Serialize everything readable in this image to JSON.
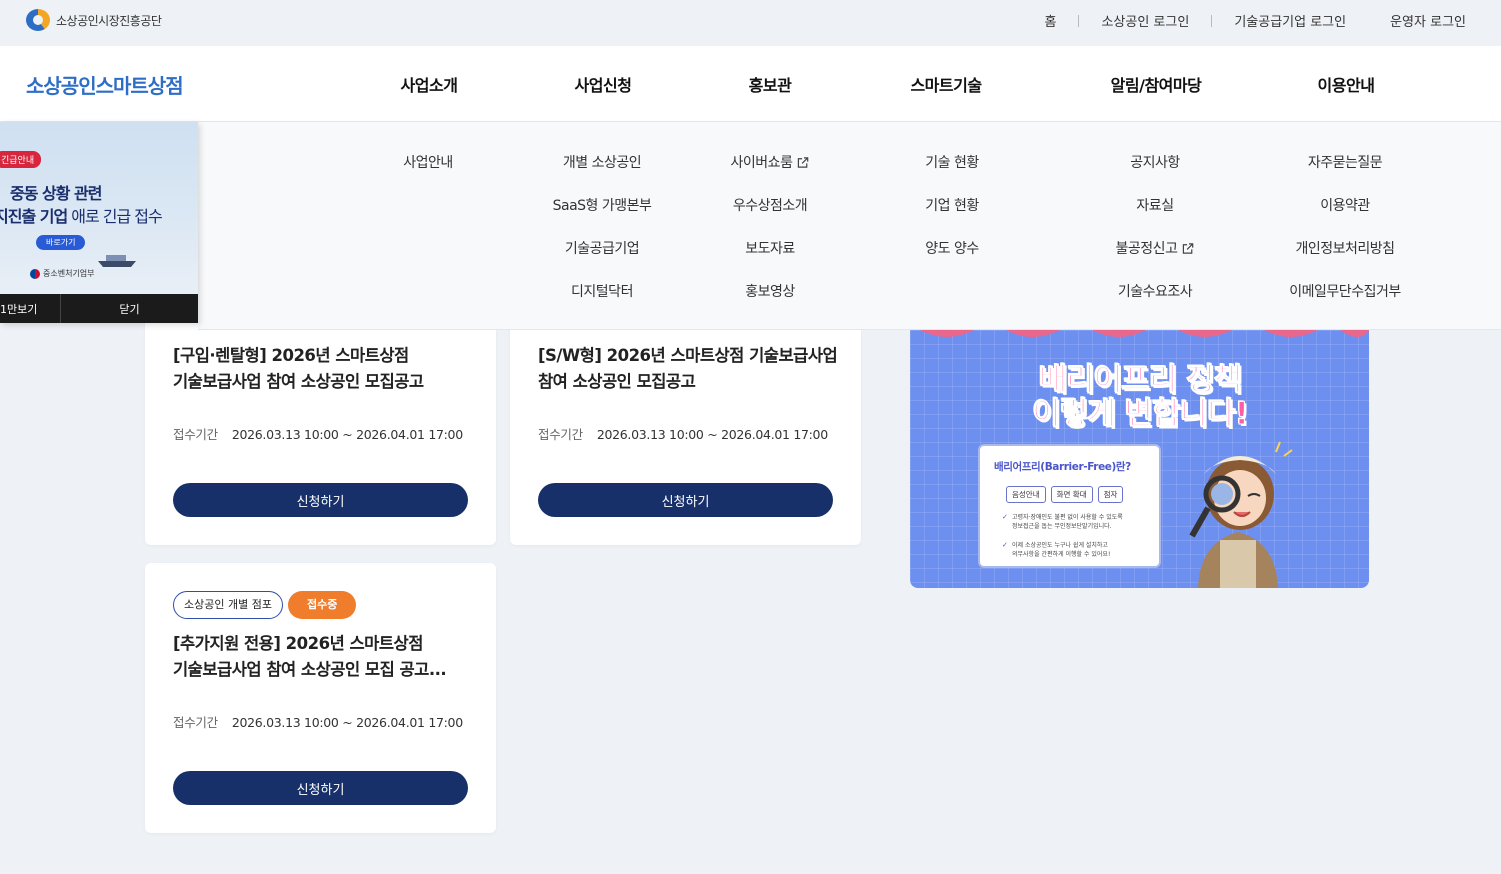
{
  "top": {
    "org_name": "소상공인시장진흥공단",
    "links": [
      "홈",
      "소상공인 로그인",
      "기술공급기업 로그인",
      "운영자 로그인"
    ]
  },
  "gnb": {
    "brand": "소상공인스마트상점",
    "menus": [
      "사업소개",
      "사업신청",
      "홍보관",
      "스마트기술",
      "알림/참여마당",
      "이용안내"
    ]
  },
  "mega": {
    "col1": [
      "사업안내"
    ],
    "col2": [
      "개별 소상공인",
      "SaaS형 가맹본부",
      "기술공급기업",
      "디지털닥터"
    ],
    "col3": [
      "사이버쇼룸",
      "우수상점소개",
      "보도자료",
      "홍보영상"
    ],
    "col4": [
      "기술 현황",
      "기업 현황",
      "양도 양수"
    ],
    "col5": [
      "공지사항",
      "자료실",
      "불공정신고",
      "기술수요조사"
    ],
    "col6": [
      "자주묻는질문",
      "이용약관",
      "개인정보처리방침",
      "이메일무단수집거부"
    ]
  },
  "popup": {
    "tag": "긴급안내",
    "line1": "중동 상황 관련",
    "line2_bold": "지진출 기업",
    "line2_rest": " 애로 긴급 접수",
    "go": "바로가기",
    "gov": "중소벤처기업부",
    "hide_today": "1만보기",
    "close": "닫기"
  },
  "cards": [
    {
      "title_line1": "[구입·렌탈형] 2026년 스마트상점",
      "title_line2": "기술보급사업 참여 소상공인 모집공고",
      "period_label": "접수기간",
      "period": "2026.03.13 10:00 ~ 2026.04.01 17:00",
      "button": "신청하기"
    },
    {
      "title_line1": "[S/W형] 2026년 스마트상점 기술보급사업",
      "title_line2": "참여 소상공인 모집공고",
      "period_label": "접수기간",
      "period": "2026.03.13 10:00 ~ 2026.04.01 17:00",
      "button": "신청하기"
    },
    {
      "type_badge": "소상공인 개별 점포",
      "status_badge": "접수중",
      "title_line1": "[추가지원 전용] 2026년 스마트상점",
      "title_line2": "기술보급사업 참여 소상공인 모집 공고...",
      "period_label": "접수기간",
      "period": "2026.03.13 10:00 ~ 2026.04.01 17:00",
      "button": "신청하기"
    }
  ],
  "promo": {
    "title1": "배리어프리 정책",
    "title2": "이렇게 변합니다!",
    "box_title": "배리어프리(Barrier-Free)란?",
    "chips": [
      "음성안내",
      "화면 확대",
      "점자"
    ],
    "line1a": "고령자·장애인도 불편 없이 사용할 수 있도록",
    "line1b": "정보접근을 돕는 무인정보단말기입니다.",
    "line2a": "이제 소상공인도 누구나 쉽게 설치하고",
    "line2b": "의무사항을 간편하게 이행할 수 있어요!"
  },
  "colors": {
    "brand": "#2f6ec7",
    "button": "#17306a",
    "status": "#ef7d2b"
  }
}
